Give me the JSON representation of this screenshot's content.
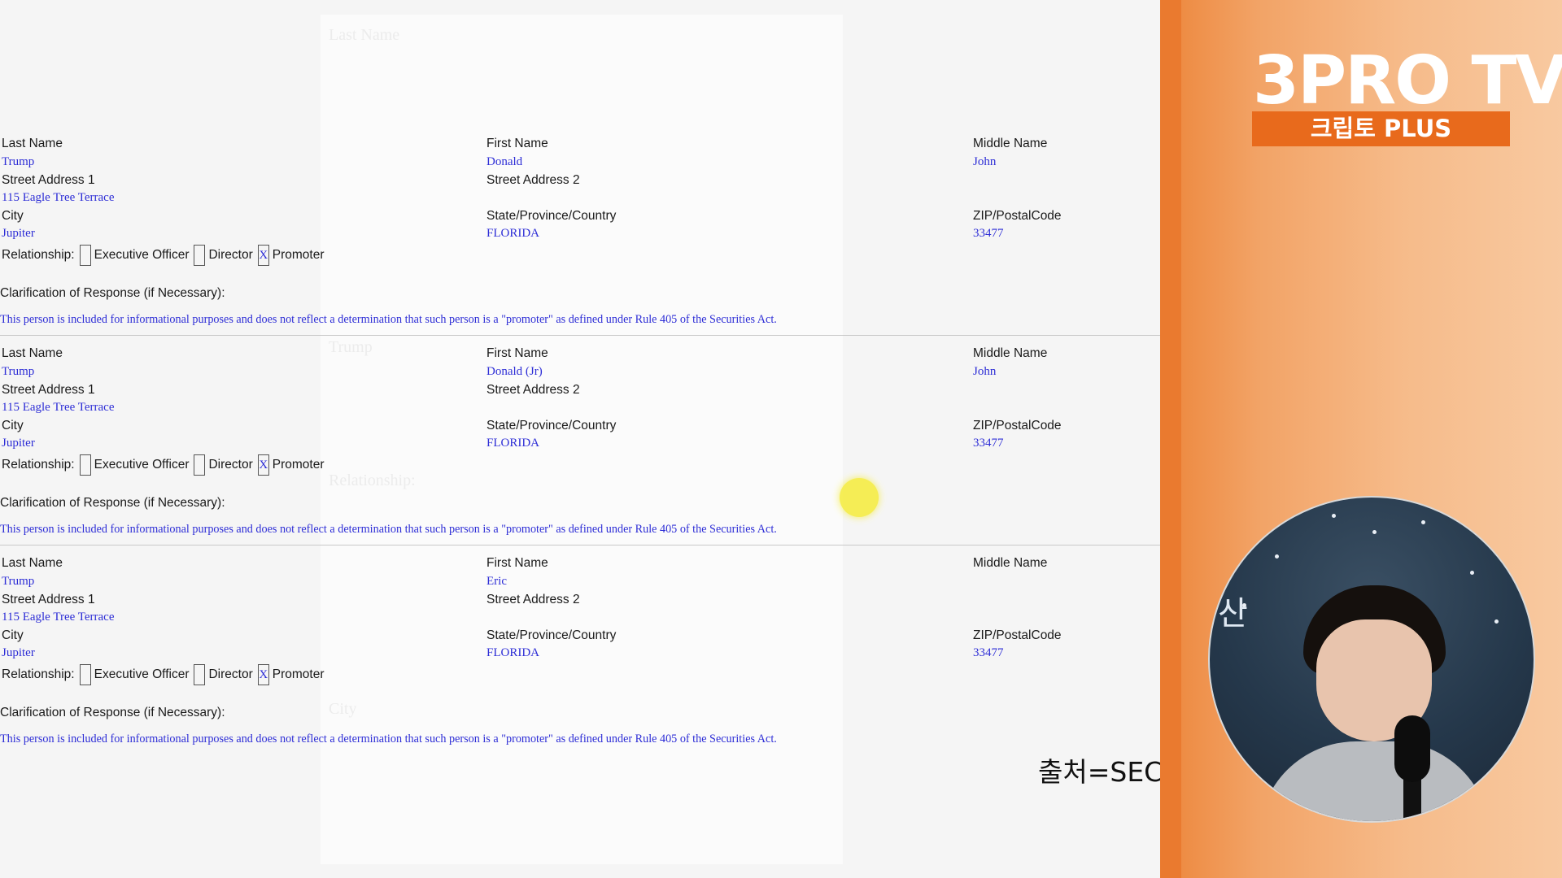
{
  "labels": {
    "last_name": "Last Name",
    "first_name": "First Name",
    "middle_name": "Middle Name",
    "street_1": "Street Address 1",
    "street_2": "Street Address 2",
    "city": "City",
    "state": "State/Province/Country",
    "zip": "ZIP/PostalCode",
    "relationship": "Relationship:",
    "executive_officer": "Executive Officer",
    "director": "Director",
    "promoter": "Promoter",
    "clarification": "Clarification of Response (if Necessary):"
  },
  "persons": [
    {
      "last_name": "Trump",
      "first_name": "Donald",
      "middle_name": "John",
      "street_1": "115 Eagle Tree Terrace",
      "street_2": "",
      "city": "Jupiter",
      "state": "FLORIDA",
      "zip": "33477",
      "executive_officer_mark": "",
      "director_mark": "",
      "promoter_mark": "X",
      "clarification": "This person is included for informational purposes and does not reflect a determination that such person is a \"promoter\" as defined under Rule 405 of the Securities Act."
    },
    {
      "last_name": "Trump",
      "first_name": "Donald (Jr)",
      "middle_name": "John",
      "street_1": "115 Eagle Tree Terrace",
      "street_2": "",
      "city": "Jupiter",
      "state": "FLORIDA",
      "zip": "33477",
      "executive_officer_mark": "",
      "director_mark": "",
      "promoter_mark": "X",
      "clarification": "This person is included for informational purposes and does not reflect a determination that such person is a \"promoter\" as defined under Rule 405 of the Securities Act."
    },
    {
      "last_name": "Trump",
      "first_name": "Eric",
      "middle_name": "",
      "street_1": "115 Eagle Tree Terrace",
      "street_2": "",
      "city": "Jupiter",
      "state": "FLORIDA",
      "zip": "33477",
      "executive_officer_mark": "",
      "director_mark": "",
      "promoter_mark": "X",
      "clarification": "This person is included for informational purposes and does not reflect a determination that such person is a \"promoter\" as defined under Rule 405 of the Securities Act."
    }
  ],
  "source_caption": "출처=SEC",
  "channel": {
    "logo": "3PRO TV",
    "sub": "크립토 PLUS"
  },
  "webcam": {
    "backdrop_text": "산"
  },
  "colors": {
    "value_blue": "#2d2dd6",
    "panel_orange": "#ee8c44",
    "logo_bar": "#e86a1c",
    "highlight": "#f5ec3a"
  }
}
